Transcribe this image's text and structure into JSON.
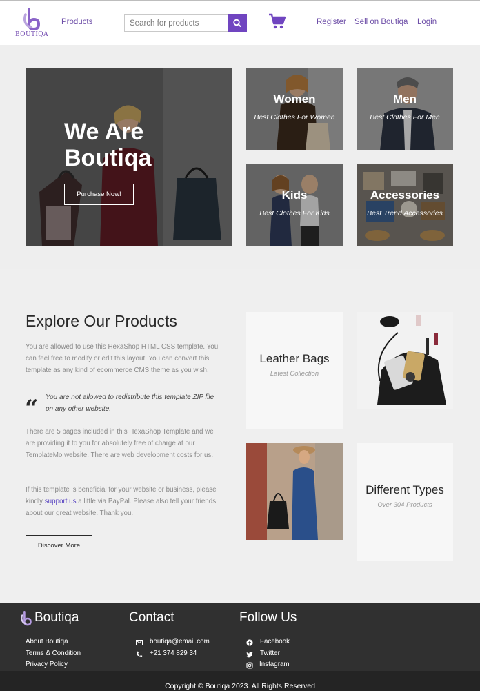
{
  "brand": {
    "logo_text": "BOUTIQA",
    "accent": "#7045c0"
  },
  "header": {
    "products_link": "Products",
    "search_placeholder": "Search for products",
    "register": "Register",
    "sell": "Sell on Boutiqa",
    "login": "Login"
  },
  "hero": {
    "title": "We Are Boutiqa",
    "button": "Purchase Now!",
    "tiles": [
      {
        "title": "Women",
        "subtitle": "Best Clothes For Women"
      },
      {
        "title": "Men",
        "subtitle": "Best Clothes For Men"
      },
      {
        "title": "Kids",
        "subtitle": "Best Clothes For Kids"
      },
      {
        "title": "Accessories",
        "subtitle": "Best Trend Accessories"
      }
    ]
  },
  "explore": {
    "title": "Explore Our Products",
    "para1": "You are allowed to use this HexaShop HTML CSS template. You can feel free to modify or edit this layout. You can convert this template as any kind of ecommerce CMS theme as you wish.",
    "quote": "You are not allowed to redistribute this template ZIP file on any other website.",
    "para2": "There are 5 pages included in this HexaShop Template and we are providing it to you for absolutely free of charge at our TemplateMo website. There are web development costs for us.",
    "para3_before": "If this template is beneficial for your website or business, please kindly ",
    "para3_link": "support us",
    "para3_after": " a little via PayPal. Please also tell your friends about our great website. Thank you.",
    "button": "Discover More",
    "cards": [
      {
        "title": "Leather Bags",
        "subtitle": "Latest Collection"
      },
      {
        "title": "Different Types",
        "subtitle": "Over 304 Products"
      }
    ]
  },
  "footer": {
    "brand": "Boutiqa",
    "links": [
      "About Boutiqa",
      "Terms & Condition",
      "Privacy Policy"
    ],
    "contact_title": "Contact",
    "email": "boutiqa@email.com",
    "phone": "+21 374 829 34",
    "follow_title": "Follow Us",
    "social": [
      "Facebook",
      "Twitter",
      "Instagram"
    ],
    "copyright": "Copyright © Boutiqa 2023. All Rights Reserved"
  }
}
